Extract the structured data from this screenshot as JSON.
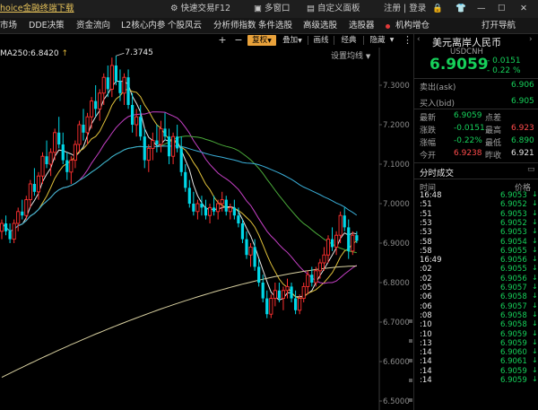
{
  "topbar": {
    "app_title": "hoice金融终端下载",
    "quick_trade": "快速交易F12",
    "multi_window": "多窗口",
    "custom_panel": "自定义面板",
    "login": "注册 | 登录"
  },
  "menubar": {
    "items": [
      "市场",
      "DDE决策",
      "资金流向",
      "L2核心内参",
      "个股风云",
      "分析师指数",
      "条件选股",
      "高级选股",
      "选股器",
      "机构增仓"
    ],
    "right": "打开导航"
  },
  "toolbar": {
    "plus": "+",
    "minus": "−",
    "adjust": "复权",
    "overlay": "叠加",
    "draw": "画线",
    "classic": "经典",
    "hide": "隐藏",
    "dropdown_arrow": "▼"
  },
  "ma_label": "MA250:6.8420",
  "settings": "设置均线",
  "peak_label": "7.3745",
  "chart_data": {
    "type": "candlestick",
    "ylim": [
      6.5,
      7.4
    ],
    "ytick_labels": [
      "7.3000",
      "7.2000",
      "7.1000",
      "7.0000",
      "6.9000",
      "6.8000",
      "6.7000",
      "6.6000",
      "6.5000"
    ],
    "annotations": [
      {
        "text": "7.3745",
        "value": 7.3745
      }
    ],
    "ma250_last": 6.842,
    "candles": [
      [
        6.93,
        6.96,
        6.91,
        6.95
      ],
      [
        6.95,
        6.97,
        6.92,
        6.93
      ],
      [
        6.93,
        6.95,
        6.9,
        6.91
      ],
      [
        6.91,
        6.96,
        6.9,
        6.95
      ],
      [
        6.95,
        6.99,
        6.93,
        6.98
      ],
      [
        6.98,
        7.01,
        6.96,
        6.97
      ],
      [
        6.97,
        7.02,
        6.96,
        7.01
      ],
      [
        7.01,
        7.06,
        6.99,
        7.05
      ],
      [
        7.05,
        7.09,
        7.02,
        7.03
      ],
      [
        7.03,
        7.08,
        7.01,
        7.07
      ],
      [
        7.07,
        7.13,
        7.05,
        7.12
      ],
      [
        7.12,
        7.16,
        7.09,
        7.1
      ],
      [
        7.1,
        7.14,
        7.07,
        7.13
      ],
      [
        7.13,
        7.19,
        7.11,
        7.18
      ],
      [
        7.18,
        7.22,
        7.14,
        7.15
      ],
      [
        7.15,
        7.18,
        7.1,
        7.11
      ],
      [
        7.11,
        7.13,
        7.06,
        7.08
      ],
      [
        7.08,
        7.12,
        7.05,
        7.11
      ],
      [
        7.11,
        7.16,
        7.09,
        7.15
      ],
      [
        7.15,
        7.21,
        7.13,
        7.2
      ],
      [
        7.2,
        7.24,
        7.16,
        7.18
      ],
      [
        7.18,
        7.23,
        7.15,
        7.22
      ],
      [
        7.22,
        7.27,
        7.19,
        7.26
      ],
      [
        7.26,
        7.3,
        7.22,
        7.24
      ],
      [
        7.24,
        7.29,
        7.21,
        7.28
      ],
      [
        7.28,
        7.33,
        7.25,
        7.32
      ],
      [
        7.32,
        7.35,
        7.27,
        7.29
      ],
      [
        7.29,
        7.37,
        7.27,
        7.35
      ],
      [
        7.35,
        7.3745,
        7.3,
        7.31
      ],
      [
        7.31,
        7.34,
        7.26,
        7.28
      ],
      [
        7.28,
        7.33,
        7.25,
        7.32
      ],
      [
        7.32,
        7.34,
        7.24,
        7.25
      ],
      [
        7.25,
        7.28,
        7.18,
        7.2
      ],
      [
        7.2,
        7.24,
        7.17,
        7.22
      ],
      [
        7.22,
        7.25,
        7.16,
        7.17
      ],
      [
        7.17,
        7.19,
        7.09,
        7.11
      ],
      [
        7.11,
        7.15,
        7.08,
        7.14
      ],
      [
        7.14,
        7.18,
        7.11,
        7.16
      ],
      [
        7.16,
        7.2,
        7.13,
        7.15
      ],
      [
        7.15,
        7.21,
        7.13,
        7.19
      ],
      [
        7.19,
        7.23,
        7.16,
        7.17
      ],
      [
        7.17,
        7.19,
        7.1,
        7.12
      ],
      [
        7.12,
        7.18,
        7.1,
        7.17
      ],
      [
        7.17,
        7.2,
        7.13,
        7.14
      ],
      [
        7.14,
        7.17,
        7.07,
        7.08
      ],
      [
        7.08,
        7.1,
        7.03,
        7.04
      ],
      [
        7.04,
        7.06,
        6.99,
        7.0
      ],
      [
        7.0,
        7.03,
        6.97,
        6.98
      ],
      [
        6.98,
        7.01,
        6.96,
        7.0
      ],
      [
        7.0,
        7.02,
        6.97,
        6.99
      ],
      [
        6.99,
        7.01,
        6.96,
        6.97
      ],
      [
        6.97,
        7.0,
        6.95,
        6.99
      ],
      [
        6.99,
        7.02,
        6.97,
        6.98
      ],
      [
        6.98,
        7.01,
        6.96,
        7.0
      ],
      [
        7.0,
        7.03,
        6.98,
        7.01
      ],
      [
        7.01,
        7.02,
        6.97,
        6.98
      ],
      [
        6.98,
        7.0,
        6.96,
        6.99
      ],
      [
        6.99,
        7.01,
        6.96,
        6.97
      ],
      [
        6.97,
        6.99,
        6.94,
        6.95
      ],
      [
        6.95,
        6.96,
        6.9,
        6.91
      ],
      [
        6.91,
        6.93,
        6.86,
        6.87
      ],
      [
        6.87,
        6.9,
        6.84,
        6.89
      ],
      [
        6.89,
        6.91,
        6.83,
        6.84
      ],
      [
        6.84,
        6.86,
        6.79,
        6.8
      ],
      [
        6.8,
        6.82,
        6.75,
        6.76
      ],
      [
        6.76,
        6.78,
        6.71,
        6.72
      ],
      [
        6.72,
        6.77,
        6.71,
        6.76
      ],
      [
        6.76,
        6.8,
        6.74,
        6.78
      ],
      [
        6.78,
        6.8,
        6.75,
        6.76
      ],
      [
        6.76,
        6.79,
        6.73,
        6.78
      ],
      [
        6.78,
        6.81,
        6.76,
        6.79
      ],
      [
        6.79,
        6.8,
        6.75,
        6.76
      ],
      [
        6.76,
        6.78,
        6.72,
        6.73
      ],
      [
        6.73,
        6.77,
        6.72,
        6.76
      ],
      [
        6.76,
        6.8,
        6.75,
        6.79
      ],
      [
        6.79,
        6.83,
        6.77,
        6.82
      ],
      [
        6.82,
        6.84,
        6.79,
        6.8
      ],
      [
        6.8,
        6.84,
        6.79,
        6.83
      ],
      [
        6.83,
        6.86,
        6.81,
        6.85
      ],
      [
        6.85,
        6.89,
        6.83,
        6.87
      ],
      [
        6.87,
        6.92,
        6.85,
        6.91
      ],
      [
        6.91,
        6.94,
        6.88,
        6.89
      ],
      [
        6.89,
        6.93,
        6.87,
        6.92
      ],
      [
        6.92,
        6.98,
        6.9,
        6.97
      ],
      [
        6.97,
        6.99,
        6.93,
        6.94
      ],
      [
        6.94,
        6.96,
        6.86,
        6.88
      ],
      [
        6.88,
        6.93,
        6.87,
        6.92
      ],
      [
        6.92,
        6.93,
        6.9,
        6.906
      ]
    ]
  },
  "side_panel": {
    "name": "美元离岸人民币",
    "code": "USDCNH",
    "price": "6.9059",
    "change": "- 0.0151",
    "change_pct": "- 0.22 %",
    "ask_label": "卖出(ask)",
    "ask_value": "6.906",
    "bid_label": "买入(bid)",
    "bid_value": "6.905",
    "latest_label": "最新",
    "latest_value": "6.9059",
    "points_label": "点差",
    "drop_label": "涨跌",
    "drop_value": "-0.0151",
    "high_label": "最高",
    "high_value": "6.923",
    "pct_label": "涨幅",
    "pct_value": "-0.22%",
    "low_label": "最低",
    "low_value": "6.890",
    "open_label": "今开",
    "open_value": "6.9238",
    "prev_label": "昨收",
    "prev_value": "6.921",
    "ticks_title": "分时成交",
    "col_time": "时间",
    "col_price": "价格",
    "ticks": [
      {
        "t": "16:48",
        "p": "6.9053",
        "c": "green"
      },
      {
        "t": ":51",
        "p": "6.9052",
        "c": "green"
      },
      {
        "t": ":51",
        "p": "6.9053",
        "c": "green"
      },
      {
        "t": ":53",
        "p": "6.9052",
        "c": "green"
      },
      {
        "t": ":53",
        "p": "6.9053",
        "c": "green"
      },
      {
        "t": ":58",
        "p": "6.9054",
        "c": "green"
      },
      {
        "t": ":58",
        "p": "6.9055",
        "c": "green"
      },
      {
        "t": "16:49",
        "p": "6.9056",
        "c": "green"
      },
      {
        "t": ":02",
        "p": "6.9055",
        "c": "green"
      },
      {
        "t": ":02",
        "p": "6.9056",
        "c": "green"
      },
      {
        "t": ":05",
        "p": "6.9057",
        "c": "green"
      },
      {
        "t": ":06",
        "p": "6.9058",
        "c": "green"
      },
      {
        "t": ":06",
        "p": "6.9057",
        "c": "green"
      },
      {
        "t": ":08",
        "p": "6.9058",
        "c": "green"
      },
      {
        "t": ":10",
        "p": "6.9058",
        "c": "green"
      },
      {
        "t": ":10",
        "p": "6.9059",
        "c": "green"
      },
      {
        "t": ":13",
        "p": "6.9059",
        "c": "green"
      },
      {
        "t": ":14",
        "p": "6.9060",
        "c": "green"
      },
      {
        "t": ":14",
        "p": "6.9061",
        "c": "green"
      },
      {
        "t": ":14",
        "p": "6.9059",
        "c": "green"
      },
      {
        "t": ":14",
        "p": "6.9059",
        "c": "green"
      }
    ]
  }
}
